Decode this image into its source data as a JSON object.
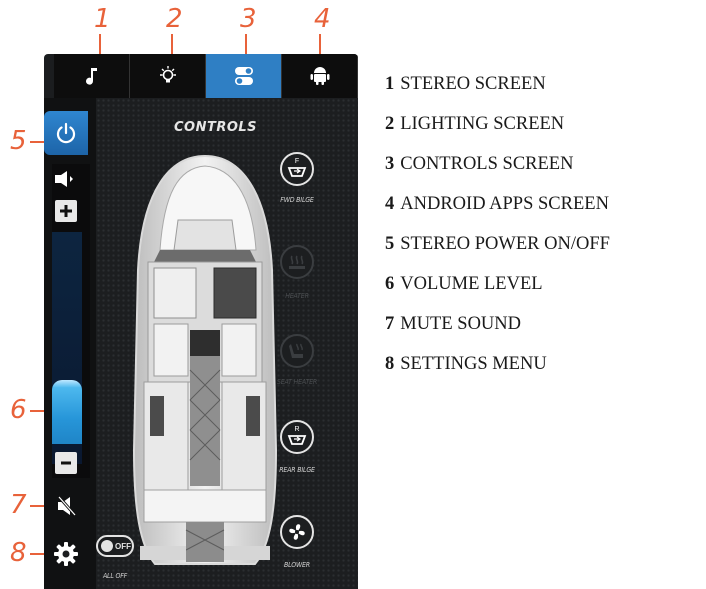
{
  "callouts": [
    "1",
    "2",
    "3",
    "4",
    "5",
    "6",
    "7",
    "8"
  ],
  "screen": {
    "title": "CONTROLS",
    "tabs": [
      {
        "icon": "music-note-icon",
        "active": false
      },
      {
        "icon": "light-bulb-icon",
        "active": false
      },
      {
        "icon": "toggle-switches-icon",
        "active": true
      },
      {
        "icon": "android-icon",
        "active": false
      }
    ],
    "controls": {
      "fwd_bilge": {
        "badge": "F",
        "label": "FWD BILGE"
      },
      "heater": {
        "label": "HEATER"
      },
      "seat_heater": {
        "label": "SEAT HEATER"
      },
      "rear_bilge": {
        "badge": "R",
        "label": "REAR BILGE"
      },
      "blower": {
        "label": "BLOWER"
      },
      "all_off": {
        "toggle_text": "OFF",
        "label": "ALL OFF"
      }
    },
    "volume_level": 0.3
  },
  "legend": [
    {
      "num": "1",
      "text": "STEREO SCREEN"
    },
    {
      "num": "2",
      "text": "LIGHTING SCREEN"
    },
    {
      "num": "3",
      "text": "CONTROLS SCREEN"
    },
    {
      "num": "4",
      "text": "ANDROID APPS SCREEN"
    },
    {
      "num": "5",
      "text": "STEREO POWER ON/OFF"
    },
    {
      "num": "6",
      "text": "VOLUME LEVEL"
    },
    {
      "num": "7",
      "text": "MUTE SOUND"
    },
    {
      "num": "8",
      "text": "SETTINGS MENU"
    }
  ],
  "colors": {
    "accent": "#e8623a",
    "active_tab": "#2f7fc4",
    "volume_fill": "#2796d9"
  }
}
